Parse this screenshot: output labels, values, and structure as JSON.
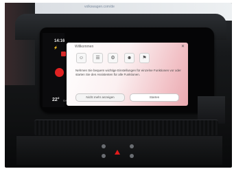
{
  "background": {
    "url_text": "volkswagen.com/de"
  },
  "status_bar": {
    "time": "14:16",
    "top_icons": "⚡",
    "temperature": "22°",
    "temperature_unit": "SYNC"
  },
  "dialog": {
    "title": "Willkommen",
    "close_symbol": "✕",
    "icons": [
      {
        "name": "profile",
        "glyph": "☺"
      },
      {
        "name": "users",
        "glyph": "☰"
      },
      {
        "name": "gear",
        "glyph": "⚙"
      },
      {
        "name": "person",
        "glyph": "☻"
      },
      {
        "name": "assist",
        "glyph": "⚑"
      }
    ],
    "body": "Nehmen Sie bequem wichtige Einstellungen für einzelne Funktionen vor oder starten Sie den Assistenten für alle Funktionen.",
    "button_secondary": "Nicht mehr anzeigen",
    "button_primary": "Starten"
  },
  "colors": {
    "screen_accent": "#eaa9b0",
    "red_indicator": "#e02222",
    "hazard": "#e21b1b"
  }
}
